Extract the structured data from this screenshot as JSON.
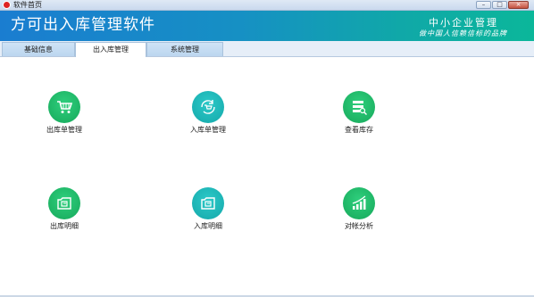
{
  "window": {
    "title": "软件首页",
    "minimize": "–",
    "maximize": "□",
    "close": "×"
  },
  "banner": {
    "app_title": "方可出入库管理软件",
    "brand_line1": "中小企业管理",
    "brand_line2": "做中国人信赖信标的品牌"
  },
  "tabs": [
    {
      "label": "基础信息",
      "active": false
    },
    {
      "label": "出入库管理",
      "active": true
    },
    {
      "label": "系统管理",
      "active": false
    }
  ],
  "tiles": [
    {
      "label": "出库单管理",
      "icon": "shopping-cart-icon",
      "color": "#1fb86a"
    },
    {
      "label": "入库单管理",
      "icon": "cart-refresh-icon",
      "color": "#1db7b9"
    },
    {
      "label": "查看库存",
      "icon": "stock-list-icon",
      "color": "#1fb86a"
    },
    {
      "label": "出库明细",
      "icon": "document-icon",
      "color": "#1fb86a"
    },
    {
      "label": "入库明细",
      "icon": "document-icon",
      "color": "#1db7b9"
    },
    {
      "label": "对帐分析",
      "icon": "bar-chart-icon",
      "color": "#1fb86a"
    }
  ]
}
